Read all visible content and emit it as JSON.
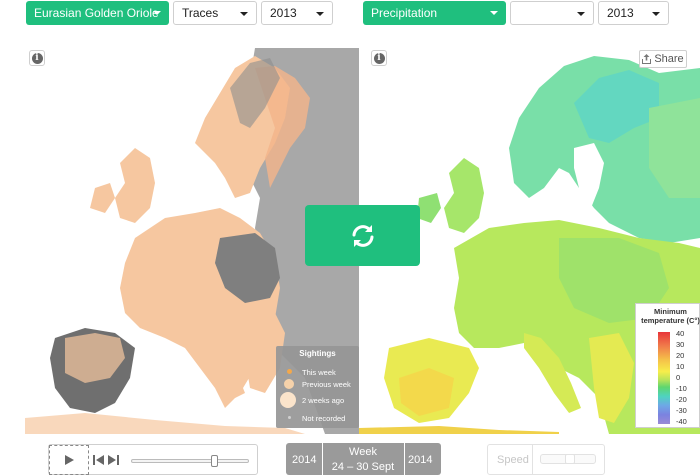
{
  "controls": {
    "species": "Eurasian Golden Oriole",
    "display_mode": "Traces",
    "left_year": "2013",
    "layer": "Precipitation",
    "layer_sub": "",
    "right_year": "2013"
  },
  "share_label": "Share",
  "sightings_legend": {
    "title": "Sightings",
    "items": [
      "This week",
      "Previous week",
      "2 weeks ago",
      "Not recorded"
    ]
  },
  "temperature_legend": {
    "title_line1": "Minimum",
    "title_line2": "temperature (C°)",
    "ticks": [
      "40",
      "30",
      "20",
      "10",
      "0",
      "-10",
      "-20",
      "-30",
      "-40"
    ],
    "colors": {
      "hot": "#e8353a",
      "mid": "#f7ee4b",
      "cool": "#5ed66f",
      "cold": "#7b82e0"
    }
  },
  "timeline": {
    "prev_year": "2014",
    "week_label": "Week",
    "week_range": "24 – 30 Sept",
    "next_year": "2014",
    "slider_position": 0.72
  },
  "speed_label": "Speed",
  "accent_color": "#1fbf7e"
}
